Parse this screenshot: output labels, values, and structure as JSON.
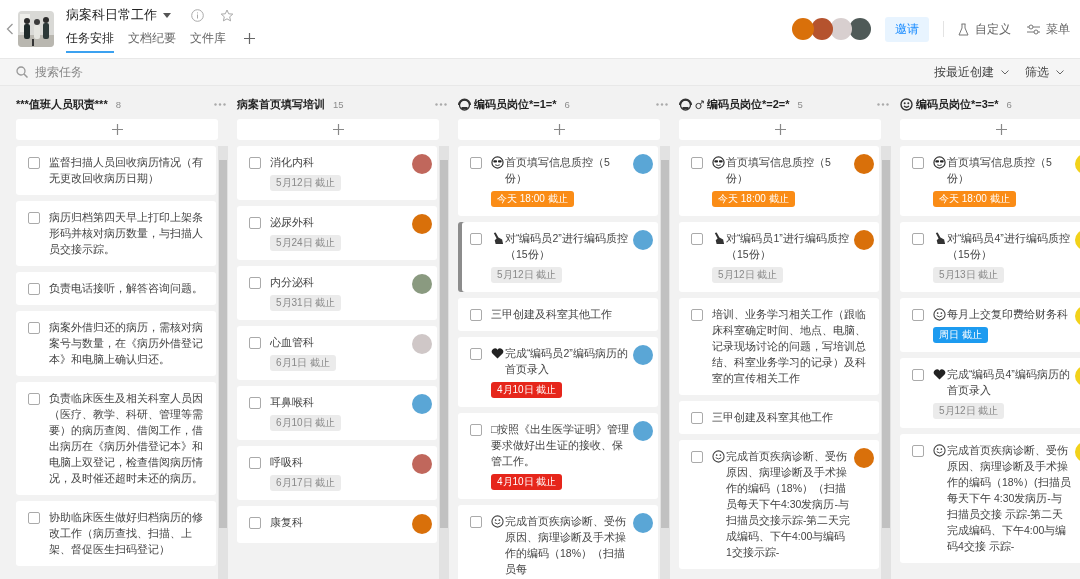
{
  "header": {
    "title": "病案科日常工作",
    "tabs": [
      {
        "label": "任务安排",
        "selected": true
      },
      {
        "label": "文档纪要",
        "selected": false
      },
      {
        "label": "文件库",
        "selected": false
      }
    ],
    "members": [
      {
        "color": "#d9700a"
      },
      {
        "color": "#b5532e"
      },
      {
        "color": "#d8cfcf"
      },
      {
        "color": "#4f5a58"
      }
    ],
    "invite": "邀请",
    "customize": "自定义",
    "menu": "菜单"
  },
  "toolbar": {
    "search_placeholder": "搜索任务",
    "sort": "按最近创建",
    "filter": "筛选"
  },
  "columns": [
    {
      "title": "***值班人员职责***",
      "count": "8",
      "kind": "plain",
      "cards": [
        {
          "kind": "plain",
          "text": "监督扫描人员回收病历情况（有无更改回收病历日期）",
          "checked": false,
          "selected": false
        },
        {
          "kind": "plain",
          "text": "病历归档第四天早上打印上架条形码并核对病历数量，与扫描人员交接示踪。",
          "checked": false,
          "selected": false
        },
        {
          "kind": "plain",
          "text": "负责电话接听，解答咨询问题。",
          "checked": false,
          "selected": false
        },
        {
          "kind": "plain",
          "text": "病案外借归还的病历，需核对病案号与数量，在《病历外借登记本》和电脑上确认归还。",
          "checked": false,
          "selected": false
        },
        {
          "kind": "plain",
          "text": "负责临床医生及相关科室人员因（医疗、教学、科研、管理等需要）的病历查阅、借阅工作，借出病历在《病历外借登记本》和电脑上双登记，检查借阅病历情况，及时催还超时未还的病历。",
          "checked": false,
          "selected": false
        },
        {
          "kind": "plain",
          "text": "协助临床医生做好归档病历的修改工作（病历查找、扫描、上架、督促医生扫码登记）",
          "checked": false,
          "selected": false
        }
      ]
    },
    {
      "title": "病案首页填写培训",
      "count": "15",
      "kind": "plain",
      "cards": [
        {
          "kind": "plain",
          "text": "消化内科",
          "due": {
            "label": "5月12日 截止",
            "color": "#ebebeb"
          },
          "color": "#c0675c",
          "checked": false,
          "selected": false
        },
        {
          "kind": "plain",
          "text": "泌尿外科",
          "due": {
            "label": "5月24日 截止",
            "color": "#ebebeb"
          },
          "color": "#d9700a",
          "checked": false,
          "selected": false
        },
        {
          "kind": "plain",
          "text": "内分泌科",
          "due": {
            "label": "5月31日 截止",
            "color": "#ebebeb"
          },
          "color": "#8a9a80",
          "checked": false,
          "selected": false
        },
        {
          "kind": "plain",
          "text": "心血管科",
          "due": {
            "label": "6月1日 截止",
            "color": "#ebebeb"
          },
          "color": "#cfc7c7",
          "checked": false,
          "selected": false
        },
        {
          "kind": "plain",
          "text": "耳鼻喉科",
          "due": {
            "label": "6月10日 截止",
            "color": "#ebebeb"
          },
          "color": "#5aa6d6",
          "checked": false,
          "selected": false
        },
        {
          "kind": "plain",
          "text": "呼吸科",
          "due": {
            "label": "6月17日 截止",
            "color": "#ebebeb"
          },
          "color": "#c0675c",
          "checked": false,
          "selected": false
        },
        {
          "kind": "plain",
          "text": "康复科",
          "color": "#d9700a",
          "checked": false,
          "selected": false
        }
      ]
    },
    {
      "title": "编码员岗位*=1=*",
      "count": "6",
      "kind": "headset",
      "cards": [
        {
          "kind": "cool",
          "text": "首页填写信息质控（5份）",
          "due": {
            "label": "今天 18:00 截止",
            "color": "#fa8c16"
          },
          "color": "#5aa6d6",
          "checked": false,
          "selected": false
        },
        {
          "kind": "hand",
          "text": "对“编码员2”进行编码质控（15份）",
          "due": {
            "label": "5月12日 截止",
            "color": "#ebebeb"
          },
          "color": "#5aa6d6",
          "checked": false,
          "selected": true
        },
        {
          "kind": "plain",
          "text": "三甲创建及科室其他工作",
          "checked": false,
          "selected": false
        },
        {
          "kind": "heart",
          "text": "完成“编码员2”编码病历的首页录入",
          "due": {
            "label": "4月10日 截止",
            "color": "#e6261b"
          },
          "color": "#5aa6d6",
          "checked": false,
          "selected": false
        },
        {
          "kind": "plain",
          "text": "□按照《出生医学证明》管理要求做好出生证的接收、保管工作。",
          "due": {
            "label": "4月10日 截止",
            "color": "#e6261b"
          },
          "color": "#5aa6d6",
          "checked": false,
          "selected": false
        },
        {
          "kind": "smile",
          "text": "完成首页疾病诊断、受伤原因、病理诊断及手术操作的编码（18%）（扫描员每",
          "color": "#5aa6d6",
          "checked": false,
          "selected": false
        }
      ]
    },
    {
      "title": "编码员岗位*=2=*",
      "count": "5",
      "kind": "headset-male",
      "cards": [
        {
          "kind": "cool",
          "text": "首页填写信息质控（5份）",
          "due": {
            "label": "今天 18:00 截止",
            "color": "#fa8c16"
          },
          "color": "#d9700a",
          "checked": false,
          "selected": false
        },
        {
          "kind": "hand",
          "text": "对“编码员1”进行编码质控（15份）",
          "due": {
            "label": "5月12日 截止",
            "color": "#ebebeb"
          },
          "color": "#d9700a",
          "checked": false,
          "selected": false
        },
        {
          "kind": "plain",
          "text": "培训、业务学习相关工作（跟临床科室确定时间、地点、电脑、记录现场讨论的问题，写培训总结、科室业务学习的记录）及科室的宣传相关工作",
          "checked": false,
          "selected": false
        },
        {
          "kind": "plain",
          "text": "三甲创建及科室其他工作",
          "checked": false,
          "selected": false
        },
        {
          "kind": "smile",
          "text": "完成首页疾病诊断、受伤原因、病理诊断及手术操作的编码（18%）（扫描员每天下午4:30发病历-与扫描员交接示踪-第二天完成编码、下午4:00与编码1交接示踪-",
          "color": "#d9700a",
          "checked": false,
          "selected": false
        }
      ]
    },
    {
      "title": "编码员岗位*=3=*",
      "count": "6",
      "kind": "smiley",
      "cards": [
        {
          "kind": "cool",
          "text": "首页填写信息质控（5份）",
          "due": {
            "label": "今天 18:00 截止",
            "color": "#fa8c16"
          },
          "color": "#f2d21a",
          "checked": false,
          "selected": false
        },
        {
          "kind": "hand",
          "text": "对“编码员4”进行编码质控（15份）",
          "due": {
            "label": "5月13日 截止",
            "color": "#ebebeb"
          },
          "color": "#f2d21a",
          "checked": false,
          "selected": false
        },
        {
          "kind": "smile",
          "text": "每月上交复印费给财务科",
          "due": {
            "label": "周日 截止",
            "color": "#1d9bf0"
          },
          "color": "#f2d21a",
          "checked": false,
          "selected": false
        },
        {
          "kind": "heart",
          "text": "完成“编码员4”编码病历的首页录入",
          "due": {
            "label": "5月12日 截止",
            "color": "#ebebeb"
          },
          "color": "#f2d21a",
          "checked": false,
          "selected": false
        },
        {
          "kind": "smile",
          "text": "完成首页疾病诊断、受伤原因、病理诊断及手术操作的编码（18%）(扫描员每天下午 4:30发病历-与扫描员交接 示踪-第二天完成编码、下午4:00与编码4交接 示踪-",
          "color": "#f2d21a",
          "checked": false,
          "selected": false
        }
      ]
    }
  ]
}
